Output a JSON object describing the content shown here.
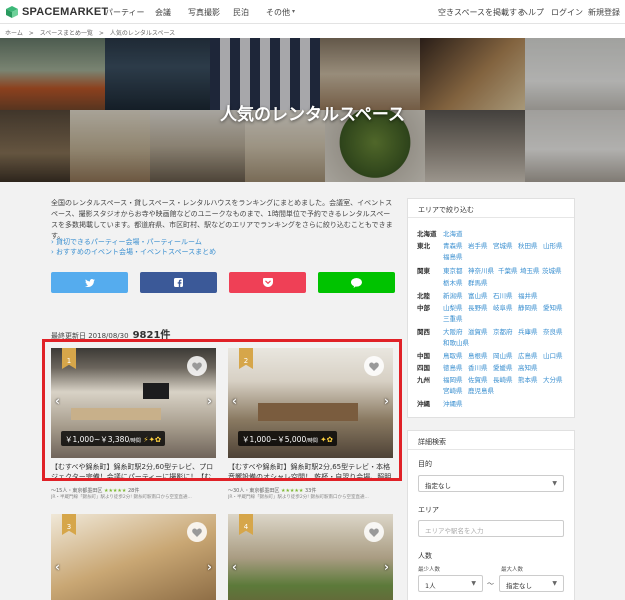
{
  "header": {
    "logo": "SPACEMARKET",
    "nav": [
      "パーティー",
      "会議",
      "写真撮影",
      "民泊",
      "その他"
    ],
    "right": [
      "空きスペースを掲載する",
      "ヘルプ",
      "ログイン",
      "新規登録"
    ]
  },
  "breadcrumb": [
    "ホーム",
    ">",
    "スペースまとめ一覧",
    ">",
    "人気のレンタルスペース"
  ],
  "hero": {
    "title": "人気のレンタルスペース"
  },
  "intro": {
    "text": "全国のレンタルスペース・貸しスペース・レンタルハウスをランキングにまとめました。会議室、イベントスペース、撮影スタジオからお寺や映画館などのユニークなものまで、1時間単位で予約できるレンタルスペースを多数掲載しています。都道府県、市区町村、駅などのエリアでランキングをさらに絞り込むこともできます。",
    "links": [
      "› 貸切できるパーティー会場・パーティールーム",
      "› おすすめのイベント会場・イベントスペースまとめ"
    ]
  },
  "share": {
    "colors": {
      "twitter": "#55acee",
      "facebook": "#3b5998",
      "pocket": "#ef4056",
      "line": "#00c300"
    }
  },
  "listing": {
    "updated": "最終更新日 2018/08/30",
    "count": "9821件"
  },
  "cards": [
    {
      "rank": "1",
      "price": "￥1,000~￥3,380",
      "price_unit": "/時間",
      "title": "【むすべや錦糸町】錦糸町駅2分,60型テレビ、プロジェクター完備！会議にパーティーに撮影に！【むか",
      "meta": "～15人・東京都墨田区",
      "stars": "★★★★★",
      "reviews": "28件",
      "line": "JR・半蔵門線「錦糸町」駅より徒歩2分! 錦糸町駅南口から空室直通..."
    },
    {
      "rank": "2",
      "price": "￥1,000~￥5,000",
      "price_unit": "/時間",
      "title": "【むすべや錦糸町】錦糸町駅2分,65型テレビ・本格音響設備のオシャレ空間！ 乾杯・自習り会場、照明器具完",
      "meta": "～30人・東京都墨田区",
      "stars": "★★★★★",
      "reviews": "33件",
      "line": "JR・半蔵門線「錦糸町」駅より徒歩2分! 錦糸町駅南口から空室直通..."
    },
    {
      "rank": "3"
    },
    {
      "rank": "4"
    }
  ],
  "area_filter": {
    "title": "エリアで絞り込む",
    "regions": [
      {
        "name": "北海道",
        "prefs": [
          "北海道"
        ]
      },
      {
        "name": "東北",
        "prefs": [
          "青森県",
          "岩手県",
          "宮城県",
          "秋田県",
          "山形県",
          "福島県"
        ]
      },
      {
        "name": "関東",
        "prefs": [
          "東京都",
          "神奈川県",
          "千葉県",
          "埼玉県",
          "茨城県",
          "栃木県",
          "群馬県"
        ]
      },
      {
        "name": "北陸",
        "prefs": [
          "新潟県",
          "富山県",
          "石川県",
          "福井県"
        ]
      },
      {
        "name": "中部",
        "prefs": [
          "山梨県",
          "長野県",
          "岐阜県",
          "静岡県",
          "愛知県",
          "三重県"
        ]
      },
      {
        "name": "関西",
        "prefs": [
          "大阪府",
          "滋賀県",
          "京都府",
          "兵庫県",
          "奈良県",
          "和歌山県"
        ]
      },
      {
        "name": "中国",
        "prefs": [
          "鳥取県",
          "島根県",
          "岡山県",
          "広島県",
          "山口県"
        ]
      },
      {
        "name": "四国",
        "prefs": [
          "徳島県",
          "香川県",
          "愛媛県",
          "高知県"
        ]
      },
      {
        "name": "九州",
        "prefs": [
          "福岡県",
          "佐賀県",
          "長崎県",
          "熊本県",
          "大分県",
          "宮崎県",
          "鹿児島県"
        ]
      },
      {
        "name": "沖縄",
        "prefs": [
          "沖縄県"
        ]
      }
    ]
  },
  "detail_search": {
    "title": "詳細検索",
    "purpose_label": "目的",
    "purpose_value": "指定なし",
    "area_label": "エリア",
    "area_placeholder": "エリアや駅名を入力",
    "people_label": "人数",
    "min_label": "最少人数",
    "max_label": "最大人数",
    "min_value": "1人",
    "tilde": "～",
    "max_value": "指定なし"
  }
}
